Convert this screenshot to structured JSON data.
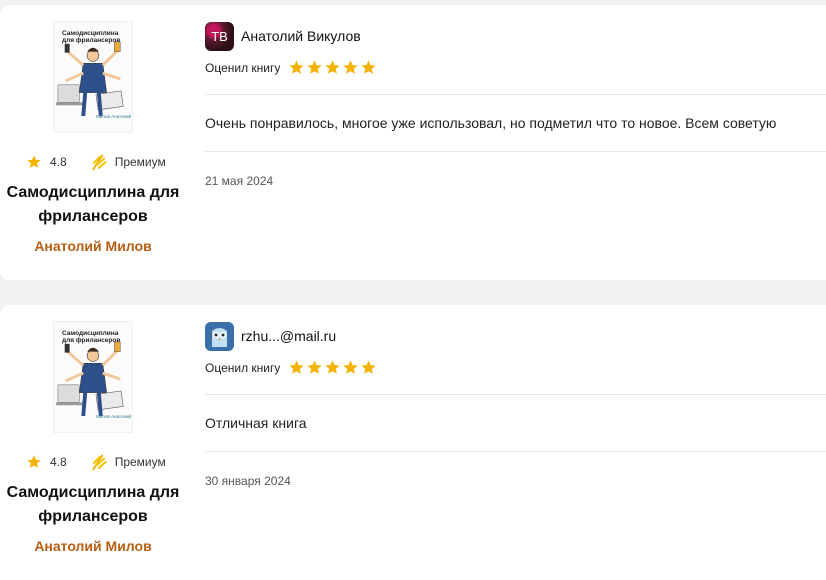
{
  "colors": {
    "star": "#f5b301",
    "author": "#b65e13"
  },
  "reviews": [
    {
      "book": {
        "cover_title": "Самодисциплина для фрилансеров",
        "cover_author": "Милов Анатолий",
        "rating": "4.8",
        "badge": "Премиум",
        "title": "Самодисциплина для фрилансеров",
        "author": "Анатолий Милов"
      },
      "user": {
        "avatar_text": "ТВ",
        "avatar_icon": "photo-avatar",
        "name": "Анатолий Викулов"
      },
      "rated_label": "Оценил книгу",
      "stars": 5,
      "text": "Очень понравилось, многое уже использовал, но подметил что то новое. Всем советую",
      "date": "21 мая 2024"
    },
    {
      "book": {
        "cover_title": "Самодисциплина для фрилансеров",
        "cover_author": "Милов Анатолий",
        "rating": "4.8",
        "badge": "Премиум",
        "title": "Самодисциплина для фрилансеров",
        "author": "Анатолий Милов"
      },
      "user": {
        "avatar_text": "",
        "avatar_icon": "owl-avatar",
        "name": "rzhu...@mail.ru"
      },
      "rated_label": "Оценил книгу",
      "stars": 5,
      "text": "Отличная книга",
      "date": "30 января 2024"
    }
  ]
}
